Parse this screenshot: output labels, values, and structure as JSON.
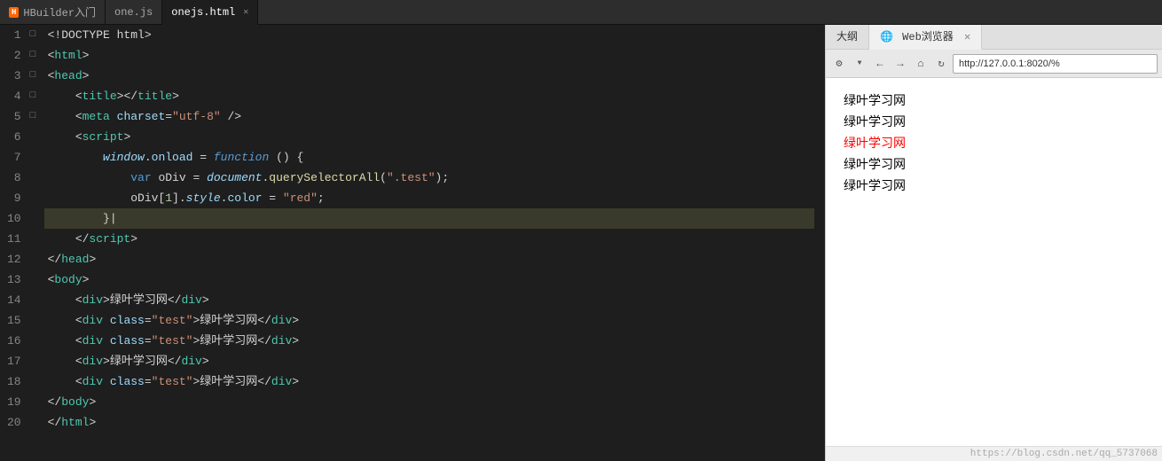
{
  "tabs": [
    {
      "id": "hbuilder",
      "label": "HBuilder入门",
      "logo": "H",
      "active": false,
      "closeable": false
    },
    {
      "id": "onejs",
      "label": "one.js",
      "active": false,
      "closeable": false
    },
    {
      "id": "onejs-html",
      "label": "onejs.html",
      "active": true,
      "closeable": true
    }
  ],
  "rightTabs": [
    {
      "id": "outline",
      "label": "大纲",
      "active": false
    },
    {
      "id": "browser",
      "label": "Web浏览器",
      "active": true,
      "closeable": true
    }
  ],
  "browserToolbar": {
    "address": "http://127.0.0.1:8020/%"
  },
  "code": {
    "lines": [
      {
        "num": "1",
        "fold": "",
        "content": "&lt;!DOCTYPE html&gt;",
        "highlight": false
      },
      {
        "num": "2",
        "fold": "□",
        "content": "&lt;<span class='c-tag'>html</span>&gt;",
        "highlight": false
      },
      {
        "num": "3",
        "fold": "□",
        "content": "&lt;<span class='c-tag'>head</span>&gt;",
        "highlight": false
      },
      {
        "num": "4",
        "fold": "",
        "content": "    &lt;<span class='c-tag'>title</span>&gt;&lt;/<span class='c-tag'>title</span>&gt;",
        "highlight": false
      },
      {
        "num": "5",
        "fold": "",
        "content": "    &lt;<span class='c-tag'>meta</span> <span class='c-attr'>charset</span>=<span class='c-value'>\"utf-8\"</span> /&gt;",
        "highlight": false
      },
      {
        "num": "6",
        "fold": "□",
        "content": "    &lt;<span class='c-tag'>script</span>&gt;",
        "highlight": false
      },
      {
        "num": "7",
        "fold": "□",
        "content": "        <span class='c-italic-obj'>window</span>.<span class='c-prop'>onload</span> = <span class='c-italic-keyword'>function</span> () {",
        "highlight": false
      },
      {
        "num": "8",
        "fold": "",
        "content": "            <span class='c-keyword'>var</span> oDiv = <span class='c-italic-obj'>document</span>.<span class='c-func'>querySelectorAll</span>(<span class='c-string'>\".test\"</span>);",
        "highlight": false
      },
      {
        "num": "9",
        "fold": "",
        "content": "            oDiv[<span class='c-number'>1</span>].<span class='c-italic-obj'>style</span>.<span class='c-prop'>color</span> = <span class='c-string'>\"red\"</span>;",
        "highlight": false
      },
      {
        "num": "10",
        "fold": "",
        "content": "        }",
        "highlight": true
      },
      {
        "num": "11",
        "fold": "",
        "content": "    &lt;/<span class='c-tag'>script</span>&gt;",
        "highlight": false
      },
      {
        "num": "12",
        "fold": "",
        "content": "&lt;/<span class='c-tag'>head</span>&gt;",
        "highlight": false
      },
      {
        "num": "13",
        "fold": "□",
        "content": "&lt;<span class='c-tag'>body</span>&gt;",
        "highlight": false
      },
      {
        "num": "14",
        "fold": "",
        "content": "    &lt;<span class='c-tag'>div</span>&gt;绿叶学习网&lt;/<span class='c-tag'>div</span>&gt;",
        "highlight": false
      },
      {
        "num": "15",
        "fold": "",
        "content": "    &lt;<span class='c-tag'>div</span> <span class='c-attr'>class</span>=<span class='c-value'>\"test\"</span>&gt;绿叶学习网&lt;/<span class='c-tag'>div</span>&gt;",
        "highlight": false
      },
      {
        "num": "16",
        "fold": "",
        "content": "    &lt;<span class='c-tag'>div</span> <span class='c-attr'>class</span>=<span class='c-value'>\"test\"</span>&gt;绿叶学习网&lt;/<span class='c-tag'>div</span>&gt;",
        "highlight": false
      },
      {
        "num": "17",
        "fold": "",
        "content": "    &lt;<span class='c-tag'>div</span>&gt;绿叶学习网&lt;/<span class='c-tag'>div</span>&gt;",
        "highlight": false
      },
      {
        "num": "18",
        "fold": "",
        "content": "    &lt;<span class='c-tag'>div</span> <span class='c-attr'>class</span>=<span class='c-value'>\"test\"</span>&gt;绿叶学习网&lt;/<span class='c-tag'>div</span>&gt;",
        "highlight": false
      },
      {
        "num": "19",
        "fold": "",
        "content": "&lt;/<span class='c-tag'>body</span>&gt;",
        "highlight": false
      },
      {
        "num": "20",
        "fold": "",
        "content": "&lt;/<span class='c-tag'>html</span>&gt;",
        "highlight": false
      }
    ]
  },
  "browserOutput": [
    {
      "text": "绿叶学习网",
      "red": false
    },
    {
      "text": "绿叶学习网",
      "red": false
    },
    {
      "text": "绿叶学习网",
      "red": true
    },
    {
      "text": "绿叶学习网",
      "red": false
    },
    {
      "text": "绿叶学习网",
      "red": false
    }
  ],
  "watermark": "https://blog.csdn.net/qq_5737068"
}
